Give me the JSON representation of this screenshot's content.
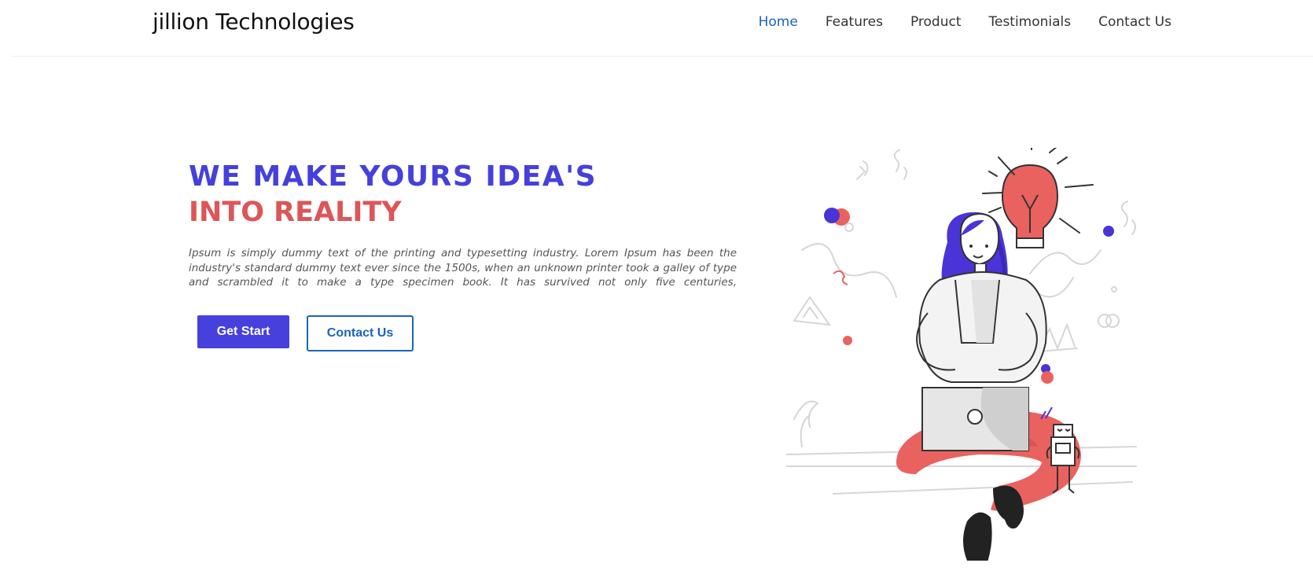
{
  "brand": {
    "name": "jillion Technologies"
  },
  "nav": {
    "items": [
      {
        "label": "Home",
        "active": true
      },
      {
        "label": "Features",
        "active": false
      },
      {
        "label": "Product",
        "active": false
      },
      {
        "label": "Testimonials",
        "active": false
      },
      {
        "label": "Contact Us",
        "active": false
      }
    ]
  },
  "hero": {
    "title_line1": "WE MAKE YOURS IDEA'S",
    "title_line2": "INTO REALITY",
    "description": "Ipsum is simply dummy text of the printing and typesetting industry. Lorem Ipsum has been the industry's standard dummy text ever since the 1500s, when an unknown printer took a galley of type and scrambled it to make a type specimen book. It has survived not only five centuries,",
    "primary_button": "Get Start",
    "secondary_button": "Contact Us"
  },
  "colors": {
    "primary_blue": "#4540dc",
    "accent_red": "#dc5658",
    "link_blue": "#1a64b8"
  },
  "icons": {
    "hero_illustration": "woman-with-laptop-illustration"
  }
}
